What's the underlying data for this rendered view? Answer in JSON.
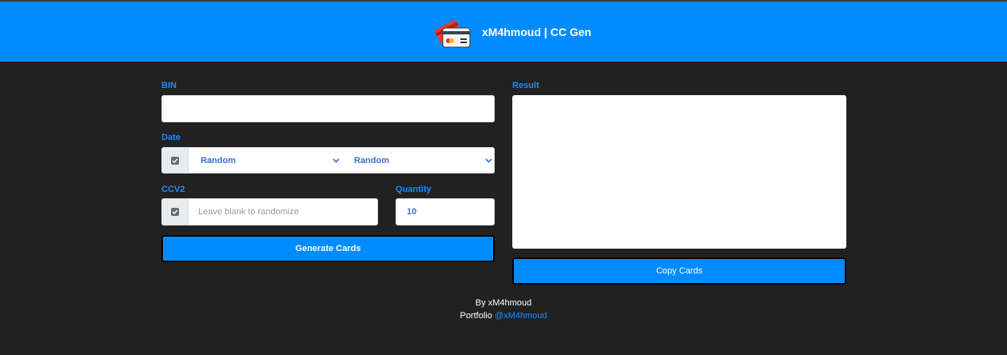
{
  "header": {
    "title": "xM4hmoud | CC Gen"
  },
  "form": {
    "bin_label": "BIN",
    "bin_value": "",
    "date_label": "Date",
    "month_selected": "Random",
    "year_selected": "Random",
    "ccv_label": "CCV2",
    "ccv_placeholder": "Leave blank to randomize",
    "quantity_label": "Quantity",
    "quantity_value": "10",
    "generate_button": "Generate Cards"
  },
  "result": {
    "label": "Result",
    "value": "",
    "copy_button": "Copy Cards"
  },
  "footer": {
    "by_text": "By xM4hmoud",
    "portfolio_prefix": "Portfolio",
    "portfolio_link": "@xM4hmoud"
  },
  "colors": {
    "header_bg": "#008cff",
    "page_bg": "#212121",
    "label": "#1a8cff",
    "button_bg": "#008cff"
  },
  "icons": [
    "credit-card-logo-icon",
    "checkbox-checked-icon",
    "chevron-down-icon"
  ]
}
